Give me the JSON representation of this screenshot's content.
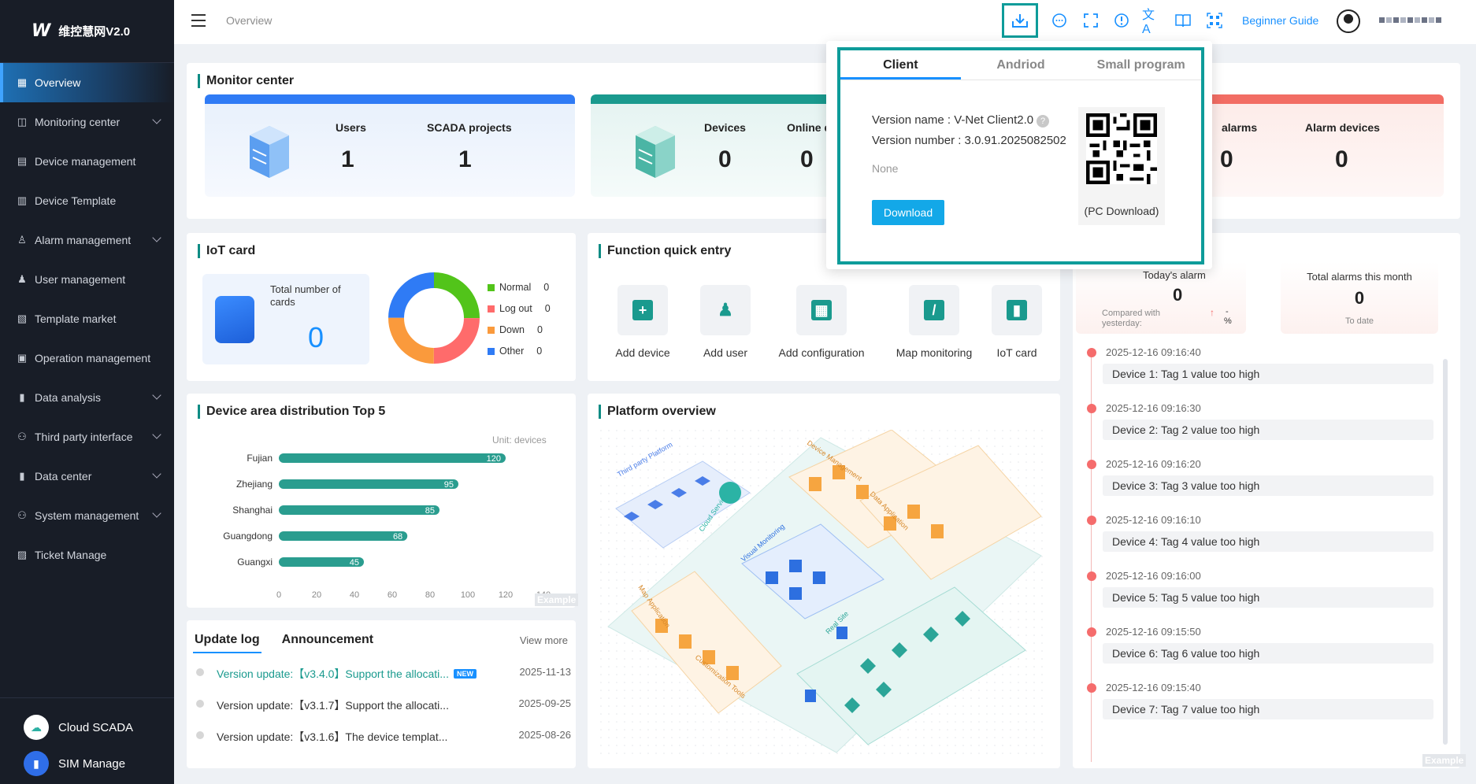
{
  "app": {
    "logo_mark": "W",
    "logo_text": "维控慧网V2.0"
  },
  "sidebar": {
    "items": [
      {
        "label": "Overview",
        "icon": "grid-icon",
        "glyph": "▦",
        "active": true,
        "expandable": false
      },
      {
        "label": "Monitoring center",
        "icon": "monitor-icon",
        "glyph": "◫",
        "expandable": true
      },
      {
        "label": "Device management",
        "icon": "device-icon",
        "glyph": "▤",
        "expandable": false
      },
      {
        "label": "Device Template",
        "icon": "template-icon",
        "glyph": "▥",
        "expandable": false
      },
      {
        "label": "Alarm management",
        "icon": "alarm-icon",
        "glyph": "♙",
        "expandable": true
      },
      {
        "label": "User management",
        "icon": "user-icon",
        "glyph": "♟",
        "expandable": false
      },
      {
        "label": "Template market",
        "icon": "market-icon",
        "glyph": "▧",
        "expandable": false
      },
      {
        "label": "Operation management",
        "icon": "operation-icon",
        "glyph": "▣",
        "expandable": false
      },
      {
        "label": "Data analysis",
        "icon": "bar-chart-icon",
        "glyph": "▮",
        "expandable": true
      },
      {
        "label": "Third party interface",
        "icon": "hierarchy-icon",
        "glyph": "⚇",
        "expandable": true
      },
      {
        "label": "Data center",
        "icon": "data-icon",
        "glyph": "▮",
        "expandable": true
      },
      {
        "label": "System management",
        "icon": "system-icon",
        "glyph": "⚇",
        "expandable": true
      },
      {
        "label": "Ticket Manage",
        "icon": "ticket-icon",
        "glyph": "▨",
        "expandable": false
      }
    ],
    "bottom": [
      {
        "label": "Cloud SCADA",
        "icon": "cloud-icon"
      },
      {
        "label": "SIM Manage",
        "icon": "sim-icon"
      }
    ]
  },
  "topbar": {
    "breadcrumb": "Overview",
    "beginner_guide": "Beginner Guide"
  },
  "monitor": {
    "title": "Monitor center",
    "users_label": "Users",
    "users_value": "1",
    "scada_label": "SCADA projects",
    "scada_value": "1",
    "devices_label": "Devices",
    "devices_value": "0",
    "online_label": "Online d",
    "online_value": "0",
    "alarms_label": "alarms",
    "alarms_value": "0",
    "alarm_devices_label": "Alarm devices",
    "alarm_devices_value": "0"
  },
  "popup": {
    "tabs": [
      "Client",
      "Andriod",
      "Small program"
    ],
    "version_name": "Version name : V-Net Client2.0",
    "version_number": "Version number : 3.0.91.2025082502",
    "note": "None",
    "download_label": "Download",
    "qr_caption": "(PC Download)"
  },
  "iot": {
    "title": "IoT card",
    "total_label": "Total number of cards",
    "total_value": "0",
    "legend": [
      {
        "label": "Normal",
        "value": "0",
        "color": "#52c41a"
      },
      {
        "label": "Log out",
        "value": "0",
        "color": "#ff6b6b"
      },
      {
        "label": "Down",
        "value": "0",
        "color": "#fa9a3c"
      },
      {
        "label": "Other",
        "value": "0",
        "color": "#2f7bf5"
      }
    ]
  },
  "quick": {
    "title": "Function quick entry",
    "items": [
      {
        "label": "Add device",
        "glyph": "+"
      },
      {
        "label": "Add user",
        "glyph": "♟"
      },
      {
        "label": "Add configuration",
        "glyph": "▦"
      },
      {
        "label": "Map monitoring",
        "glyph": "/"
      },
      {
        "label": "IoT card",
        "glyph": "▮"
      }
    ]
  },
  "alarm_panel": {
    "today_label": "Today's alarm",
    "today_value": "0",
    "compared_label": "Compared with yesterday:",
    "compared_value": "-",
    "compared_unit": "%",
    "month_label": "Total alarms this month",
    "month_value": "0",
    "month_sub": "To date",
    "events": [
      {
        "time": "2025-12-16 09:16:40",
        "msg": "Device 1: Tag 1 value too high"
      },
      {
        "time": "2025-12-16 09:16:30",
        "msg": "Device 2: Tag 2 value too high"
      },
      {
        "time": "2025-12-16 09:16:20",
        "msg": "Device 3: Tag 3 value too high"
      },
      {
        "time": "2025-12-16 09:16:10",
        "msg": "Device 4: Tag 4 value too high"
      },
      {
        "time": "2025-12-16 09:16:00",
        "msg": "Device 5: Tag 5 value too high"
      },
      {
        "time": "2025-12-16 09:15:50",
        "msg": "Device 6: Tag 6 value too high"
      },
      {
        "time": "2025-12-16 09:15:40",
        "msg": "Device 7: Tag 7 value too high"
      }
    ],
    "example": "Example"
  },
  "distribution": {
    "title": "Device area distribution Top 5",
    "unit": "Unit: devices",
    "example": "Example"
  },
  "platform": {
    "title": "Platform overview",
    "labels": [
      "Third party Platform",
      "Device Management",
      "Data Application",
      "Cloud Service",
      "Visual Monitoring",
      "Map Application",
      "Customization Tools",
      "Real Site"
    ]
  },
  "updates": {
    "tabs": [
      "Update log",
      "Announcement"
    ],
    "view_more": "View more",
    "items": [
      {
        "text": "Version update:【v3.4.0】Support the allocati...",
        "date": "2025-11-13",
        "new": true,
        "badge": "NEW",
        "highlight": true
      },
      {
        "text": "Version update:【v3.1.7】Support the allocati...",
        "date": "2025-09-25",
        "new": false,
        "highlight": false
      },
      {
        "text": "Version update:【v3.1.6】The device templat...",
        "date": "2025-08-26",
        "new": false,
        "highlight": false
      }
    ]
  },
  "colors": {
    "accent": "#1890ff",
    "teal": "#0e9c9a",
    "bar": "#2a9d8f",
    "alarm": "#f56c6c"
  },
  "chart_data": {
    "type": "bar",
    "orientation": "horizontal",
    "title": "Device area distribution Top 5",
    "unit": "Unit: devices",
    "categories": [
      "Fujian",
      "Zhejiang",
      "Shanghai",
      "Guangdong",
      "Guangxi"
    ],
    "values": [
      120,
      95,
      85,
      68,
      45
    ],
    "xlim": [
      0,
      140
    ],
    "xticks": [
      0,
      20,
      40,
      60,
      80,
      100,
      120,
      140
    ],
    "grid": false
  }
}
